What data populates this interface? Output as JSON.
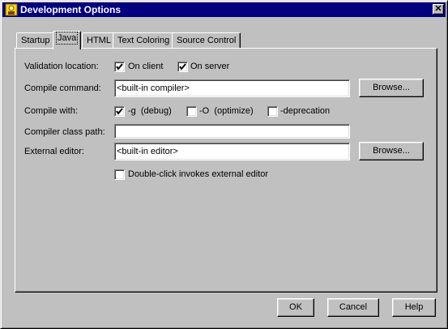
{
  "window": {
    "title": "Development Options",
    "close_glyph": "✕",
    "icon": "app-icon"
  },
  "tabs": [
    {
      "label": "Startup",
      "active": false
    },
    {
      "label": "Java",
      "active": true
    },
    {
      "label": "HTML",
      "active": false
    },
    {
      "label": "Text Coloring",
      "active": false
    },
    {
      "label": "Source Control",
      "active": false
    }
  ],
  "java": {
    "validation_location": {
      "label": "Validation location:",
      "on_client": {
        "label": "On client",
        "checked": true
      },
      "on_server": {
        "label": "On server",
        "checked": true
      }
    },
    "compile_command": {
      "label": "Compile command:",
      "value": "<built-in compiler>",
      "browse_label": "Browse..."
    },
    "compile_with": {
      "label": "Compile with:",
      "debug": {
        "label": "-g  (debug)",
        "checked": true
      },
      "optimize": {
        "label": "-O  (optimize)",
        "checked": false
      },
      "deprecation": {
        "label": "-deprecation",
        "checked": false
      }
    },
    "compiler_class_path": {
      "label": "Compiler class path:",
      "value": ""
    },
    "external_editor": {
      "label": "External editor:",
      "value": "<built-in editor>",
      "browse_label": "Browse..."
    },
    "double_click": {
      "label": "Double-click invokes external editor",
      "checked": false
    }
  },
  "footer": {
    "ok_label": "OK",
    "cancel_label": "Cancel",
    "help_label": "Help"
  },
  "colors": {
    "titlebar": "#000080",
    "face": "#c0c0c0"
  }
}
